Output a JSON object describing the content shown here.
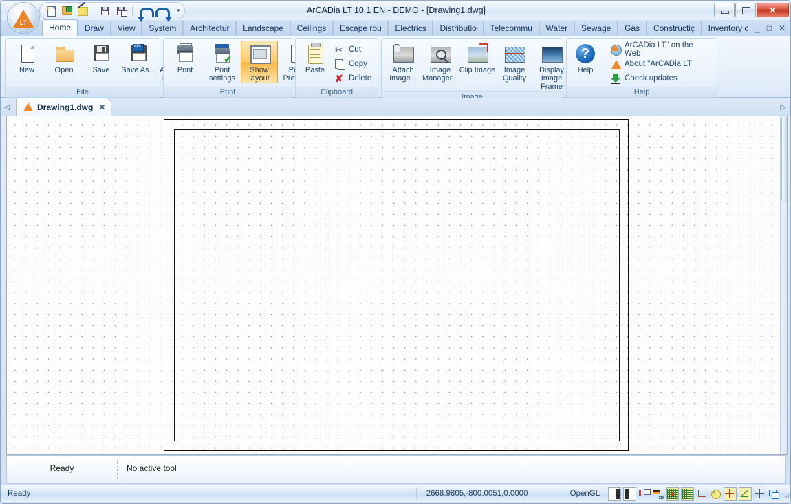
{
  "window": {
    "title": "ArCADia LT 10.1 EN - DEMO  - [Drawing1.dwg]",
    "logo_label": "LT",
    "minimize": "",
    "maximize": "",
    "close": "✕"
  },
  "quick_access": {
    "items": [
      {
        "name": "new-document-icon",
        "tooltip": "New"
      },
      {
        "name": "open-document-icon",
        "tooltip": "Open"
      },
      {
        "name": "edit-pencil-icon",
        "tooltip": "Edit"
      },
      {
        "name": "save-icon",
        "tooltip": "Save"
      },
      {
        "name": "save-as-icon",
        "tooltip": "Save As"
      },
      {
        "name": "undo-icon",
        "tooltip": "Undo"
      },
      {
        "name": "redo-icon",
        "tooltip": "Redo"
      }
    ],
    "overflow_glyph": "▾"
  },
  "ribbon_tabs": [
    {
      "label": "Home",
      "active": true
    },
    {
      "label": "Draw",
      "active": false
    },
    {
      "label": "View",
      "active": false
    },
    {
      "label": "System",
      "active": false
    },
    {
      "label": "Architectur",
      "active": false
    },
    {
      "label": "Landscape",
      "active": false
    },
    {
      "label": "Ceilings",
      "active": false
    },
    {
      "label": "Escape rou",
      "active": false
    },
    {
      "label": "Electrics",
      "active": false
    },
    {
      "label": "Distributio",
      "active": false
    },
    {
      "label": "Telecommu",
      "active": false
    },
    {
      "label": "Water",
      "active": false
    },
    {
      "label": "Sewage",
      "active": false
    },
    {
      "label": "Gas",
      "active": false
    },
    {
      "label": "Constructiç",
      "active": false
    },
    {
      "label": "Inventory c",
      "active": false
    }
  ],
  "mdi_controls": {
    "minimize": "_",
    "restore": "□",
    "close": "✕"
  },
  "ribbon_groups": [
    {
      "title": "File",
      "buttons": [
        {
          "label": "New",
          "icon": "new-document-icon",
          "selected": false
        },
        {
          "label": "Open",
          "icon": "open-folder-icon",
          "selected": false
        },
        {
          "label": "Save",
          "icon": "save-floppy-icon",
          "selected": false
        },
        {
          "label": "Save As...",
          "icon": "save-as-icon",
          "selected": false
        },
        {
          "label": "Autosave settings",
          "icon": "autosave-settings-icon",
          "selected": false
        }
      ]
    },
    {
      "title": "Print",
      "buttons": [
        {
          "label": "Print",
          "icon": "printer-icon",
          "selected": false
        },
        {
          "label": "Print settings",
          "icon": "print-settings-icon",
          "selected": false
        },
        {
          "label": "Show layout",
          "icon": "show-layout-icon",
          "selected": true
        },
        {
          "label": "Print Preview",
          "icon": "print-preview-icon",
          "selected": false
        }
      ]
    },
    {
      "title": "Clipboard",
      "buttons": [
        {
          "label": "Paste",
          "icon": "paste-clipboard-icon",
          "selected": false
        }
      ],
      "small_buttons": [
        {
          "label": "Cut",
          "icon": "scissors-icon"
        },
        {
          "label": "Copy",
          "icon": "copy-pages-icon"
        },
        {
          "label": "Delete",
          "icon": "delete-x-icon"
        }
      ]
    },
    {
      "title": "Image",
      "buttons": [
        {
          "label": "Attach Image...",
          "icon": "attach-image-icon",
          "selected": false
        },
        {
          "label": "Image Manager...",
          "icon": "image-manager-icon",
          "selected": false
        },
        {
          "label": "Clip Image",
          "icon": "clip-image-icon",
          "selected": false
        },
        {
          "label": "Image Quality",
          "icon": "image-quality-icon",
          "selected": false
        },
        {
          "label": "Display Image Frame",
          "icon": "display-image-frame-icon",
          "selected": false
        }
      ]
    },
    {
      "title": "Help",
      "buttons": [
        {
          "label": "Help",
          "icon": "help-question-icon",
          "selected": false
        }
      ],
      "small_buttons": [
        {
          "label": "ArCADia LT\" on the Web",
          "icon": "globe-icon"
        },
        {
          "label": "About  \"ArCADia LT",
          "icon": "about-triangle-icon"
        },
        {
          "label": "Check updates",
          "icon": "download-arrow-icon"
        }
      ]
    }
  ],
  "document_tabs": {
    "prev_arrow": "◁",
    "next_arrow": "▷",
    "tabs": [
      {
        "label": "Drawing1.dwg",
        "close": "✕",
        "active": true
      }
    ]
  },
  "canvas": {
    "grid_enabled": true,
    "page_frame_visible": true
  },
  "info_panes": {
    "status": "Ready",
    "tool": "No active tool"
  },
  "status_bar": {
    "message": "Ready",
    "coordinates": "2668.9805,-800.0051,0.0000",
    "renderer": "OpenGL",
    "toggles": [
      {
        "name": "left-pane-toggle-icon",
        "state": "off"
      },
      {
        "name": "right-pane-toggle-icon",
        "state": "off"
      },
      {
        "name": "layers-toggle-icon",
        "state": "off"
      },
      {
        "name": "view-3d-toggle-icon",
        "state": "off"
      },
      {
        "name": "snap-grid-toggle-icon",
        "state": "on"
      },
      {
        "name": "grid-toggle-icon",
        "state": "on"
      },
      {
        "name": "ortho-toggle-icon",
        "state": "off"
      },
      {
        "name": "polar-tracking-toggle-icon",
        "state": "on"
      },
      {
        "name": "object-snap-toggle-icon",
        "state": "on"
      },
      {
        "name": "angle-snap-toggle-icon",
        "state": "on"
      },
      {
        "name": "crosshair-toggle-icon",
        "state": "off"
      },
      {
        "name": "window-toggle-icon",
        "state": "off"
      }
    ],
    "resize_grip": "resize-grip-icon"
  },
  "colors": {
    "accent": "#1d6dc0",
    "highlight": "#f8b94a",
    "titlebar": "#e2ecf8",
    "close_button": "#d9513c",
    "logo_orange": "#ef8023"
  }
}
